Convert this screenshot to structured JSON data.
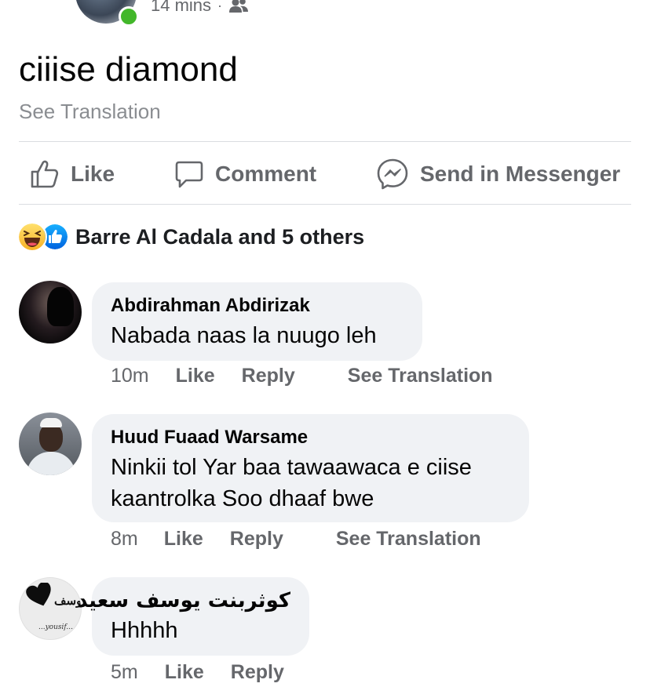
{
  "header": {
    "time_ago": "14 mins",
    "separator": "·",
    "audience_icon": "friends-icon"
  },
  "post": {
    "text": "ciiise diamond",
    "see_translation": "See Translation"
  },
  "actions": {
    "like": "Like",
    "comment": "Comment",
    "send": "Send in Messenger"
  },
  "reactions": {
    "types": [
      "haha",
      "like"
    ],
    "summary": "Barre Al Cadala and 5 others"
  },
  "comments": [
    {
      "author": "Abdirahman Abdirizak",
      "text": "Nabada naas la nuugo leh",
      "time": "10m",
      "like": "Like",
      "reply": "Reply",
      "see_translation": "See Translation"
    },
    {
      "author": "Huud Fuaad Warsame",
      "text": "Ninkii tol Yar baa tawaawaca e ciise kaantrolka Soo dhaaf bwe",
      "time": "8m",
      "like": "Like",
      "reply": "Reply",
      "see_translation": "See Translation"
    },
    {
      "author": "كوثربنت يوسف سعيد",
      "text": "Hhhhh",
      "time": "5m",
      "like": "Like",
      "reply": "Reply",
      "avatar_logo_text": "يوسف",
      "avatar_logo_subtext": "...yousif..."
    }
  ],
  "colors": {
    "accent_blue": "#1877f2",
    "online_green": "#42b72a",
    "bubble_bg": "#f0f2f5",
    "secondary_text": "#65676b"
  }
}
